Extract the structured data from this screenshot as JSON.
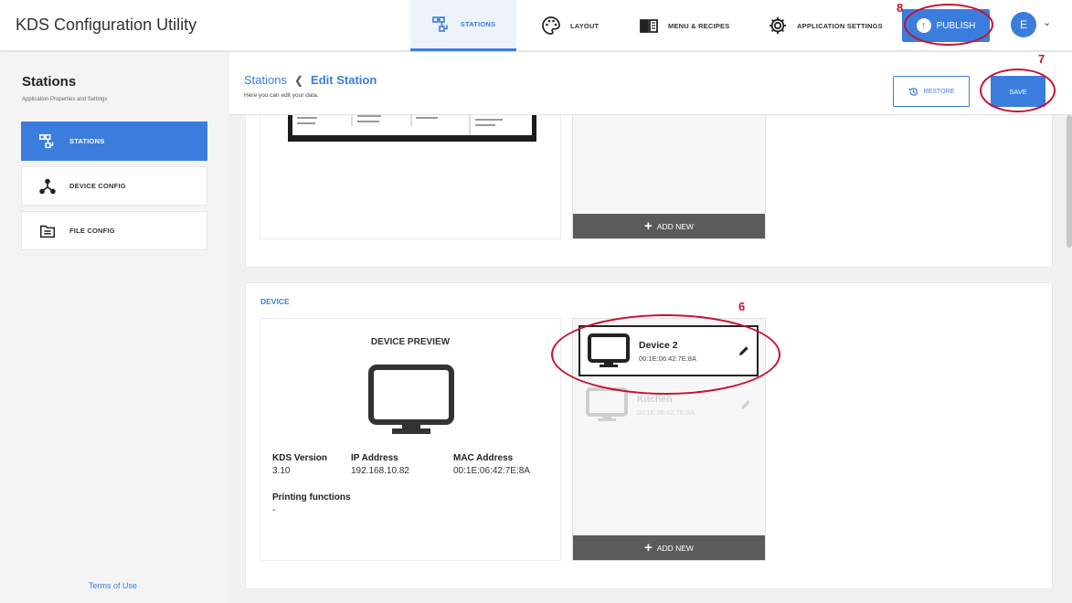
{
  "app": {
    "title": "KDS Configuration Utility"
  },
  "nav": {
    "tabs": [
      {
        "label": "STATIONS",
        "icon": "stations-icon"
      },
      {
        "label": "LAYOUT",
        "icon": "palette-icon"
      },
      {
        "label": "MENU & RECIPES",
        "icon": "book-icon"
      },
      {
        "label": "APPLICATION SETTINGS",
        "icon": "gear-icon"
      }
    ],
    "publish_label": "PUBLISH",
    "avatar_initial": "E"
  },
  "sidebar": {
    "title": "Stations",
    "subtitle": "Application Properties and Settings",
    "items": [
      {
        "label": "STATIONS",
        "icon": "stations-icon"
      },
      {
        "label": "DEVICE CONFIG",
        "icon": "network-icon"
      },
      {
        "label": "FILE CONFIG",
        "icon": "file-list-icon"
      }
    ],
    "terms_label": "Terms of Use"
  },
  "header": {
    "breadcrumb_root": "Stations",
    "breadcrumb_current": "Edit Station",
    "subtitle": "Here you can edit your data.",
    "restore_label": "RESTORE",
    "save_label": "SAVE"
  },
  "layout_section": {
    "add_new_label": "ADD NEW"
  },
  "device_section": {
    "label": "DEVICE",
    "preview_title": "DEVICE PREVIEW",
    "info": {
      "kds_version_label": "KDS Version",
      "kds_version": "3.10",
      "ip_label": "IP Address",
      "ip": "192.168.10.82",
      "mac_label": "MAC Address",
      "mac": "00:1E:06:42:7E:8A",
      "printing_label": "Printing functions",
      "printing": "-"
    },
    "devices": [
      {
        "name": "Device 2",
        "mac": "00:1E:06:42:7E:8A"
      },
      {
        "name": "Kitchen",
        "mac": "00:1E:06:42:7E:8A"
      }
    ],
    "add_new_label": "ADD NEW"
  },
  "annotations": {
    "a6": "6",
    "a7": "7",
    "a8": "8"
  },
  "colors": {
    "accent": "#3b7ddd",
    "annotation": "#c8102e",
    "add_bar": "#5b5b5b"
  }
}
